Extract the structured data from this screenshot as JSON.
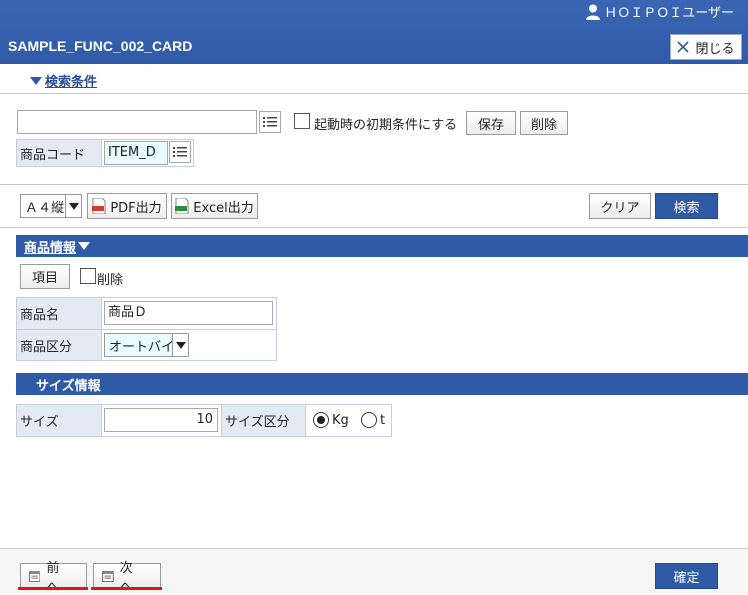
{
  "header": {
    "user_label": "ＨＯＩＰＯＩユーザー",
    "app_title": "SAMPLE_FUNC_002_CARD",
    "close_label": "閉じる"
  },
  "search": {
    "toggle_label": "検索条件",
    "initial_condition_label": "起動時の初期条件にする",
    "save_label": "保存",
    "delete_label": "削除",
    "product_code_label": "商品コード",
    "product_code_value": "ITEM_D",
    "paper_size": "Ａ４縦",
    "pdf_label": "PDF出力",
    "excel_label": "Excel出力",
    "clear_label": "クリア",
    "search_label": "検索"
  },
  "product_section": {
    "title": "商品情報",
    "item_button": "項目",
    "delete_label": "削除",
    "name_label": "商品名",
    "name_value": "商品Ｄ",
    "category_label": "商品区分",
    "category_value": "オートバイ"
  },
  "size_section": {
    "title": "サイズ情報",
    "size_label": "サイズ",
    "size_value": "10",
    "unit_label": "サイズ区分",
    "unit_options": [
      "Kg",
      "t"
    ],
    "unit_selected": "Kg"
  },
  "footer": {
    "prev_label": "前　へ",
    "next_label": "次　へ",
    "confirm_label": "確定"
  },
  "colors": {
    "brand_blue": "#2f5aa6",
    "nav_underline": "#e0141e"
  }
}
